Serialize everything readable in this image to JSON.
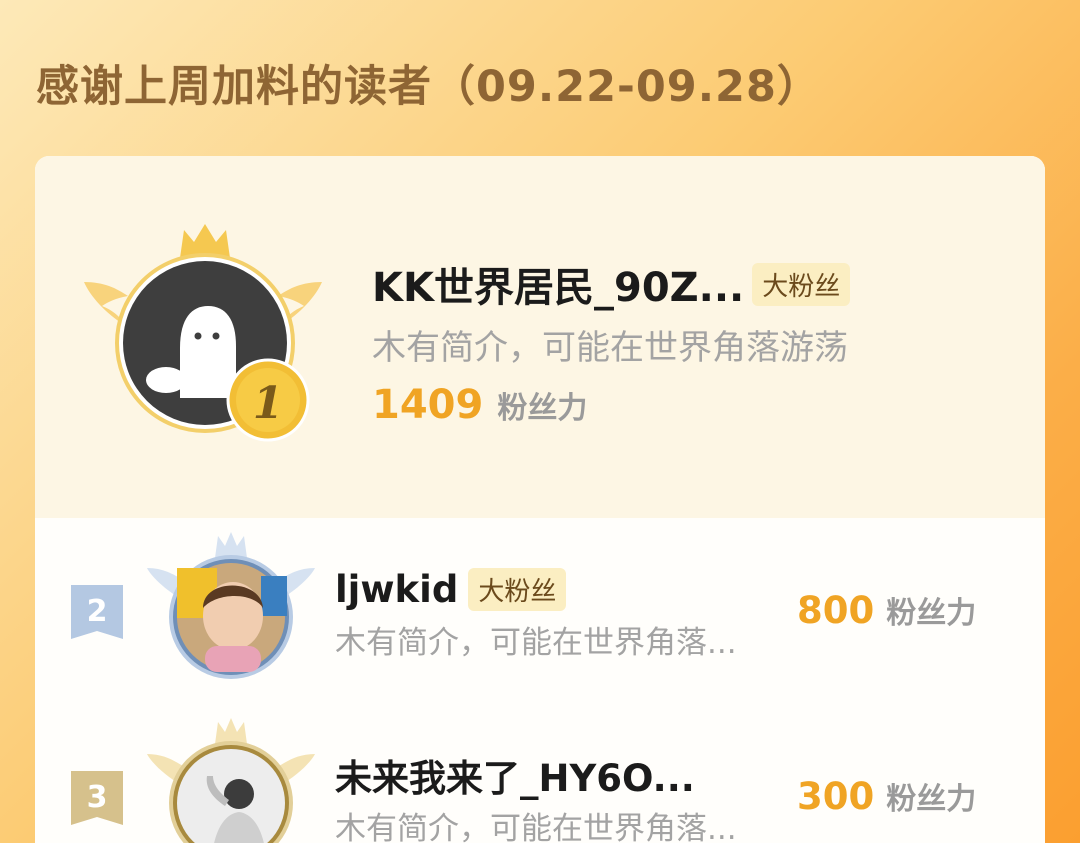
{
  "header": {
    "title": "感谢上周加料的读者（09.22-09.28）"
  },
  "colors": {
    "accent_gold": "#f0a424",
    "title_brown": "#8e6534",
    "badge_bg": "#fbeec2"
  },
  "readers": [
    {
      "rank": "1",
      "name": "KK世界居民_90Z...",
      "badge": "大粉丝",
      "bio": "木有简介，可能在世界角落游荡",
      "score": "1409",
      "score_unit": "粉丝力",
      "avatar": "default-ghost-avatar"
    },
    {
      "rank": "2",
      "name": "ljwkid",
      "badge": "大粉丝",
      "bio": "木有简介，可能在世界角落...",
      "score": "800",
      "score_unit": "粉丝力",
      "avatar": "child-photo-avatar"
    },
    {
      "rank": "3",
      "name": "未来我来了_HY6O...",
      "badge": "",
      "bio": "木有简介，可能在世界角落...",
      "score": "300",
      "score_unit": "粉丝力",
      "avatar": "person-photo-avatar"
    }
  ]
}
